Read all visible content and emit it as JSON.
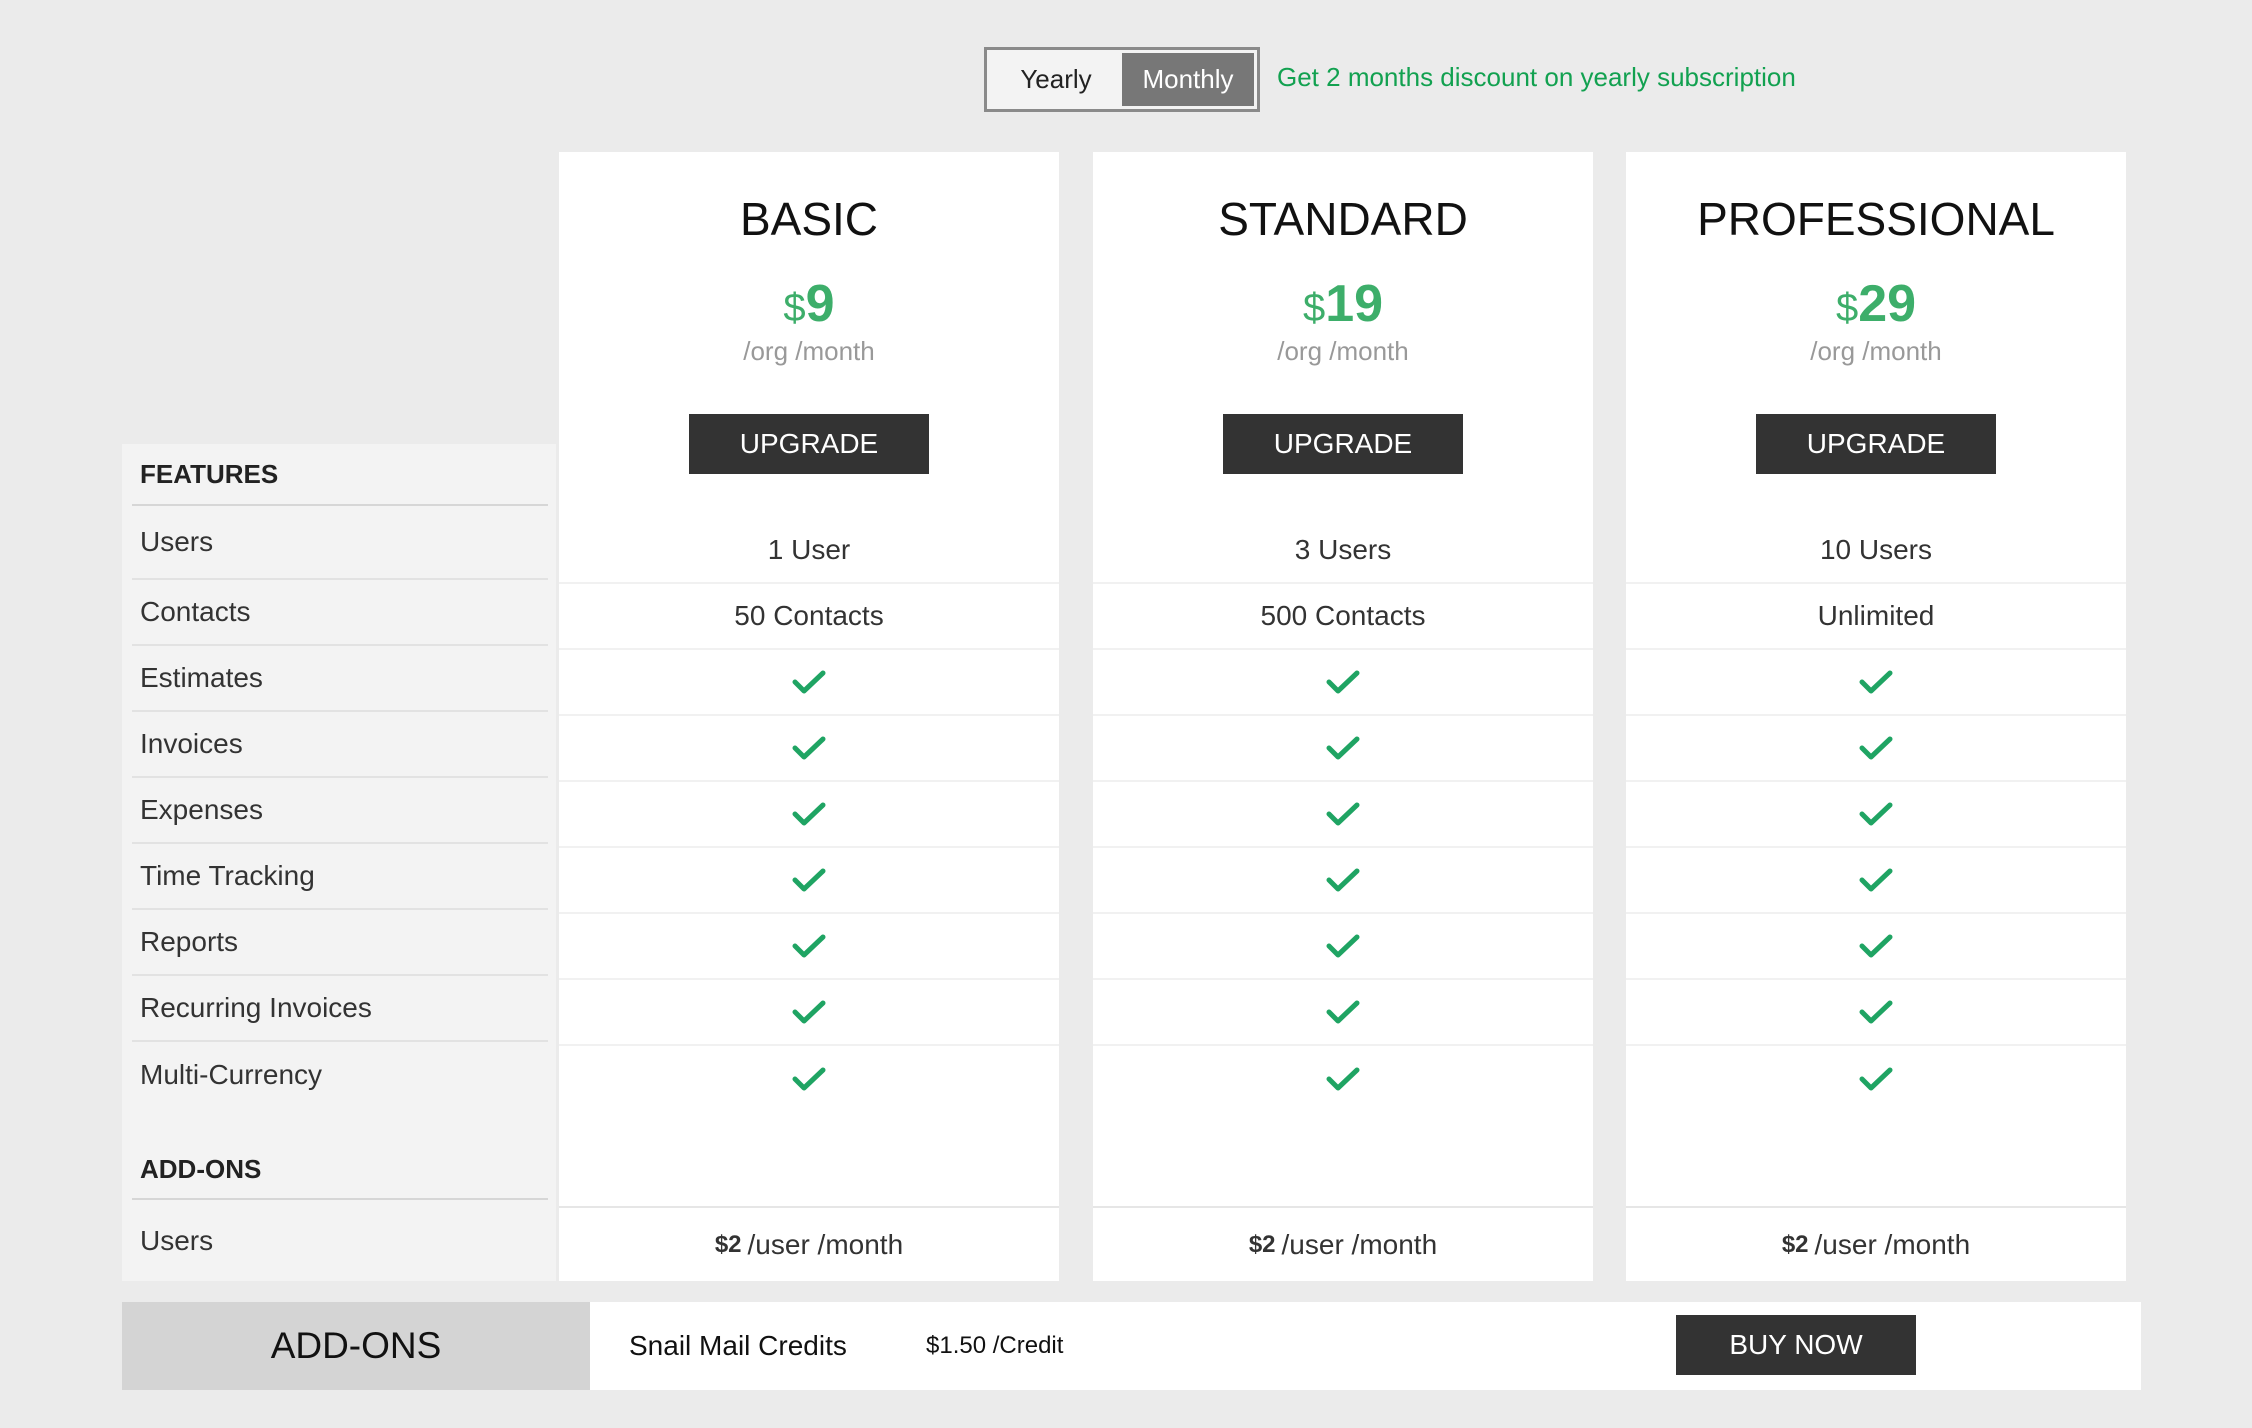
{
  "toggle": {
    "yearly": "Yearly",
    "monthly": "Monthly",
    "selected": "Monthly"
  },
  "promo": "Get 2 months discount on yearly subscription",
  "features": {
    "header": "FEATURES",
    "items": [
      "Users",
      "Contacts",
      "Estimates",
      "Invoices",
      "Expenses",
      "Time Tracking",
      "Reports",
      "Recurring Invoices",
      "Multi-Currency"
    ],
    "addons_header": "ADD-ONS",
    "addons_items": [
      "Users"
    ]
  },
  "plans": [
    {
      "name": "BASIC",
      "currency": "$",
      "price": "9",
      "period": "/org /month",
      "button": "UPGRADE",
      "users": "1 User",
      "contacts": "50 Contacts",
      "addon_price": "$2",
      "addon_unit": "/user /month"
    },
    {
      "name": "STANDARD",
      "currency": "$",
      "price": "19",
      "period": "/org /month",
      "button": "UPGRADE",
      "users": "3 Users",
      "contacts": "500 Contacts",
      "addon_price": "$2",
      "addon_unit": "/user /month"
    },
    {
      "name": "PROFESSIONAL",
      "currency": "$",
      "price": "29",
      "period": "/org /month",
      "button": "UPGRADE",
      "users": "10 Users",
      "contacts": "Unlimited",
      "addon_price": "$2",
      "addon_unit": "/user /month"
    }
  ],
  "checkmark_icon": "check-icon",
  "addons_bar": {
    "title": "ADD-ONS",
    "item": "Snail Mail Credits",
    "price": "$1.50 /Credit",
    "button": "BUY NOW"
  },
  "colors": {
    "accent": "#3dae6a",
    "check": "#1fa463",
    "promo": "#12a150",
    "button": "#333333"
  }
}
